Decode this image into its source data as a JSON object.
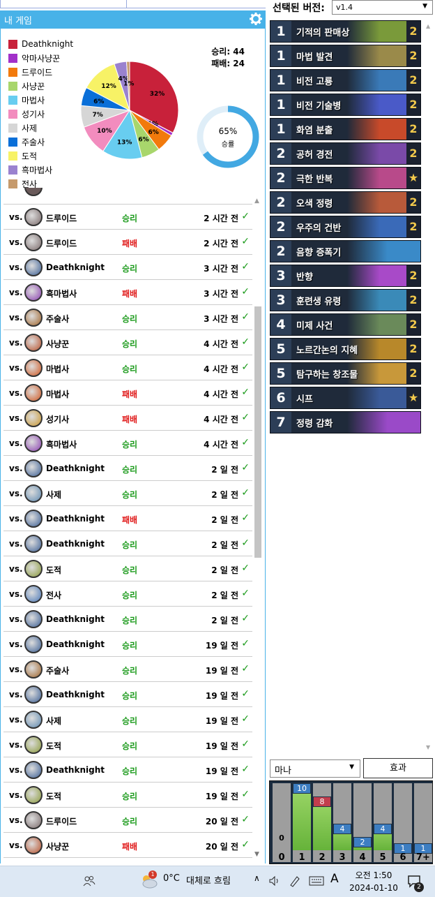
{
  "left_panel": {
    "header_title": "내 게임",
    "legend": [
      {
        "label": "Deathknight",
        "color": "#c8213a"
      },
      {
        "label": "악마사냥꾼",
        "color": "#a230c9"
      },
      {
        "label": "드루이드",
        "color": "#f27a0c"
      },
      {
        "label": "사냥꾼",
        "color": "#a8d66c"
      },
      {
        "label": "마법사",
        "color": "#68cdf0"
      },
      {
        "label": "성기사",
        "color": "#f28cbe"
      },
      {
        "label": "사제",
        "color": "#d6d6d6"
      },
      {
        "label": "주술사",
        "color": "#0a6fd8"
      },
      {
        "label": "도적",
        "color": "#f7f266"
      },
      {
        "label": "흑마법사",
        "color": "#9a82cf"
      },
      {
        "label": "전사",
        "color": "#c69a6c"
      }
    ],
    "wins_text": "승리: 44",
    "losses_text": "패배: 24",
    "win_rate_text": "65%",
    "win_rate_label": "승률",
    "win_rate": 0.65,
    "chart_data": {
      "type": "pie",
      "categories": [
        "Deathknight",
        "악마사냥꾼",
        "드루이드",
        "사냥꾼",
        "마법사",
        "성기사",
        "사제",
        "주술사",
        "도적",
        "흑마법사",
        "전사"
      ],
      "values": [
        32,
        1,
        6,
        6,
        13,
        10,
        7,
        6,
        12,
        4,
        1
      ],
      "labels": [
        "32%",
        "1%",
        "6%",
        "6%",
        "13%",
        "10%",
        "7%",
        "6%",
        "12%",
        "4%",
        "1%"
      ],
      "colors": [
        "#c8213a",
        "#a230c9",
        "#f27a0c",
        "#a8d66c",
        "#68cdf0",
        "#f28cbe",
        "#d6d6d6",
        "#0a6fd8",
        "#f7f266",
        "#9a82cf",
        "#c69a6c"
      ]
    },
    "games": [
      {
        "vs": "vs.",
        "opponent": "드루이드",
        "result": "승리",
        "win": true,
        "time": "2 시간 전",
        "icon": "druid-icon",
        "color": "#7a6a6a"
      },
      {
        "vs": "vs.",
        "opponent": "드루이드",
        "result": "패배",
        "win": false,
        "time": "2 시간 전",
        "icon": "druid-icon",
        "color": "#7a6a6a"
      },
      {
        "vs": "vs.",
        "opponent": "Deathknight",
        "result": "승리",
        "win": true,
        "time": "3 시간 전",
        "icon": "deathknight-icon",
        "color": "#3b5f95"
      },
      {
        "vs": "vs.",
        "opponent": "흑마법사",
        "result": "패배",
        "win": false,
        "time": "3 시간 전",
        "icon": "warlock-icon",
        "color": "#8a3fb0"
      },
      {
        "vs": "vs.",
        "opponent": "주술사",
        "result": "승리",
        "win": true,
        "time": "3 시간 전",
        "icon": "shaman-icon",
        "color": "#a0642a"
      },
      {
        "vs": "vs.",
        "opponent": "사냥꾼",
        "result": "승리",
        "win": true,
        "time": "4 시간 전",
        "icon": "hunter-icon",
        "color": "#b8502a"
      },
      {
        "vs": "vs.",
        "opponent": "마법사",
        "result": "승리",
        "win": true,
        "time": "4 시간 전",
        "icon": "mage-icon",
        "color": "#d0561f"
      },
      {
        "vs": "vs.",
        "opponent": "마법사",
        "result": "패배",
        "win": false,
        "time": "4 시간 전",
        "icon": "mage-icon",
        "color": "#d0561f"
      },
      {
        "vs": "vs.",
        "opponent": "성기사",
        "result": "패배",
        "win": false,
        "time": "4 시간 전",
        "icon": "paladin-icon",
        "color": "#c9962e"
      },
      {
        "vs": "vs.",
        "opponent": "흑마법사",
        "result": "승리",
        "win": true,
        "time": "4 시간 전",
        "icon": "warlock-icon",
        "color": "#8a3fb0"
      },
      {
        "vs": "vs.",
        "opponent": "Deathknight",
        "result": "승리",
        "win": true,
        "time": "2 일 전",
        "icon": "deathknight-icon",
        "color": "#3b5f95"
      },
      {
        "vs": "vs.",
        "opponent": "사제",
        "result": "승리",
        "win": true,
        "time": "2 일 전",
        "icon": "priest-icon",
        "color": "#5d89b0"
      },
      {
        "vs": "vs.",
        "opponent": "Deathknight",
        "result": "패배",
        "win": false,
        "time": "2 일 전",
        "icon": "deathknight-icon",
        "color": "#3b5f95"
      },
      {
        "vs": "vs.",
        "opponent": "Deathknight",
        "result": "승리",
        "win": true,
        "time": "2 일 전",
        "icon": "deathknight-icon",
        "color": "#3b5f95"
      },
      {
        "vs": "vs.",
        "opponent": "도적",
        "result": "승리",
        "win": true,
        "time": "2 일 전",
        "icon": "rogue-icon",
        "color": "#8a9a3a"
      },
      {
        "vs": "vs.",
        "opponent": "전사",
        "result": "승리",
        "win": true,
        "time": "2 일 전",
        "icon": "warrior-icon",
        "color": "#4a78b8"
      },
      {
        "vs": "vs.",
        "opponent": "Deathknight",
        "result": "승리",
        "win": true,
        "time": "2 일 전",
        "icon": "deathknight-icon",
        "color": "#3b5f95"
      },
      {
        "vs": "vs.",
        "opponent": "Deathknight",
        "result": "승리",
        "win": true,
        "time": "19 일 전",
        "icon": "deathknight-icon",
        "color": "#3b5f95"
      },
      {
        "vs": "vs.",
        "opponent": "주술사",
        "result": "승리",
        "win": true,
        "time": "19 일 전",
        "icon": "shaman-icon",
        "color": "#a0642a"
      },
      {
        "vs": "vs.",
        "opponent": "Deathknight",
        "result": "승리",
        "win": true,
        "time": "19 일 전",
        "icon": "deathknight-icon",
        "color": "#3b5f95"
      },
      {
        "vs": "vs.",
        "opponent": "사제",
        "result": "승리",
        "win": true,
        "time": "19 일 전",
        "icon": "priest-icon",
        "color": "#5d89b0"
      },
      {
        "vs": "vs.",
        "opponent": "도적",
        "result": "승리",
        "win": true,
        "time": "19 일 전",
        "icon": "rogue-icon",
        "color": "#8a9a3a"
      },
      {
        "vs": "vs.",
        "opponent": "Deathknight",
        "result": "승리",
        "win": true,
        "time": "19 일 전",
        "icon": "deathknight-icon",
        "color": "#3b5f95"
      },
      {
        "vs": "vs.",
        "opponent": "도적",
        "result": "승리",
        "win": true,
        "time": "19 일 전",
        "icon": "rogue-icon",
        "color": "#8a9a3a"
      },
      {
        "vs": "vs.",
        "opponent": "드루이드",
        "result": "승리",
        "win": true,
        "time": "20 일 전",
        "icon": "druid-icon",
        "color": "#7a6a6a"
      },
      {
        "vs": "vs.",
        "opponent": "사냥꾼",
        "result": "패배",
        "win": false,
        "time": "20 일 전",
        "icon": "hunter-icon",
        "color": "#b8502a"
      }
    ]
  },
  "right_panel": {
    "version_label": "선택된 버전:",
    "version_value": "v1.4",
    "cards": [
      {
        "cost": "1",
        "name": "기적의 판매상",
        "count": "2",
        "art": "#7a9a3a"
      },
      {
        "cost": "1",
        "name": "마법 발견",
        "count": "2",
        "art": "#9a8a4a"
      },
      {
        "cost": "1",
        "name": "비전 고룡",
        "count": "2",
        "art": "#3a7ab8"
      },
      {
        "cost": "1",
        "name": "비전 기술병",
        "count": "2",
        "art": "#4a5ac8"
      },
      {
        "cost": "1",
        "name": "화염 분출",
        "count": "2",
        "art": "#c84a2a"
      },
      {
        "cost": "2",
        "name": "공허 경전",
        "count": "2",
        "art": "#7a4aa8"
      },
      {
        "cost": "2",
        "name": "극한 반복",
        "count": "★",
        "art": "#b84a8a"
      },
      {
        "cost": "2",
        "name": "오색 정령",
        "count": "2",
        "art": "#b85a3a"
      },
      {
        "cost": "2",
        "name": "우주의 건반",
        "count": "2",
        "art": "#3a6ab8"
      },
      {
        "cost": "2",
        "name": "음향 증폭기",
        "count": "",
        "art": "#3a8ac8"
      },
      {
        "cost": "3",
        "name": "반향",
        "count": "2",
        "art": "#a84ac8"
      },
      {
        "cost": "3",
        "name": "훈련생 유령",
        "count": "2",
        "art": "#3a8ab8"
      },
      {
        "cost": "4",
        "name": "미제 사건",
        "count": "2",
        "art": "#6a8a5a"
      },
      {
        "cost": "5",
        "name": "노르간논의 지혜",
        "count": "2",
        "art": "#b8882a"
      },
      {
        "cost": "5",
        "name": "탐구하는 창조물",
        "count": "2",
        "art": "#c8983a"
      },
      {
        "cost": "6",
        "name": "시프",
        "count": "★",
        "art": "#3a5a98"
      },
      {
        "cost": "7",
        "name": "정령 감화",
        "count": "",
        "art": "#9a4ac8"
      }
    ],
    "mana_select": "마나",
    "effect_button": "효과",
    "curve": {
      "labels": [
        "0",
        "1",
        "2",
        "3",
        "4",
        "5",
        "6",
        "7+"
      ],
      "values": [
        0,
        10,
        8,
        4,
        2,
        4,
        1,
        1
      ],
      "chart_data": {
        "type": "bar",
        "categories": [
          "0",
          "1",
          "2",
          "3",
          "4",
          "5",
          "6",
          "7+"
        ],
        "values": [
          0,
          10,
          8,
          4,
          2,
          4,
          1,
          1
        ]
      }
    }
  },
  "taskbar": {
    "weather_temp": "0°C",
    "weather_text": "대체로 흐림",
    "weather_badge": "1",
    "input_lang": "A",
    "time": "오전 1:50",
    "date": "2024-01-10",
    "notif_count": "2"
  }
}
